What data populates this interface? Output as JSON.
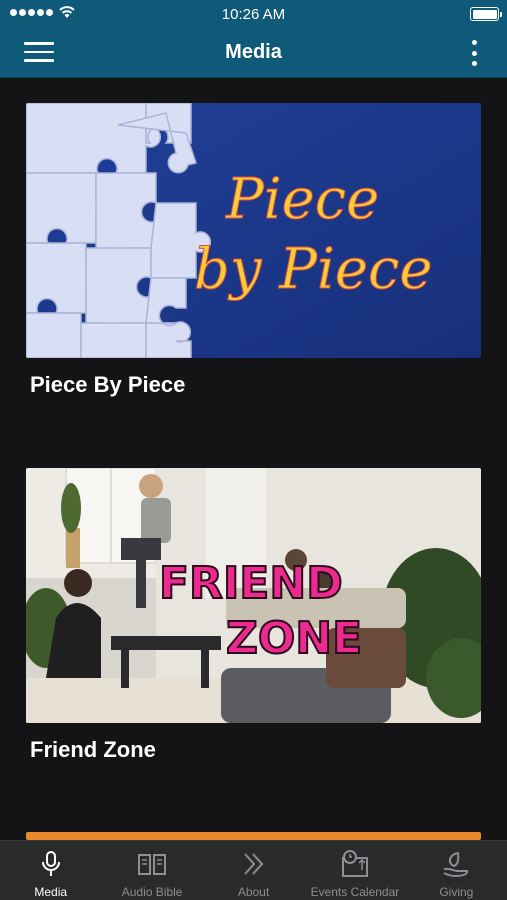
{
  "status_bar": {
    "time": "10:26 AM"
  },
  "header": {
    "title": "Media"
  },
  "media_items": [
    {
      "title": "Piece By Piece",
      "artwork_text_line1": "Piece",
      "artwork_text_line2": "by Piece",
      "colors": {
        "background": "#1c3a8a",
        "accent": "#f4cc3c"
      }
    },
    {
      "title": "Friend Zone",
      "artwork_text_line1": "FRIEND",
      "artwork_text_line2": "ZONE",
      "colors": {
        "accent": "#ec2a8f"
      }
    }
  ],
  "tabs": [
    {
      "label": "Media",
      "icon": "microphone-icon",
      "active": true
    },
    {
      "label": "Audio Bible",
      "icon": "open-book-icon",
      "active": false
    },
    {
      "label": "About",
      "icon": "double-chevron-right-icon",
      "active": false
    },
    {
      "label": "Events Calendar",
      "icon": "calendar-clock-icon",
      "active": false
    },
    {
      "label": "Giving",
      "icon": "leaf-hand-icon",
      "active": false
    }
  ],
  "colors": {
    "header": "#0f5a78",
    "background": "#141416",
    "tab_bar": "#2a2a2c"
  }
}
